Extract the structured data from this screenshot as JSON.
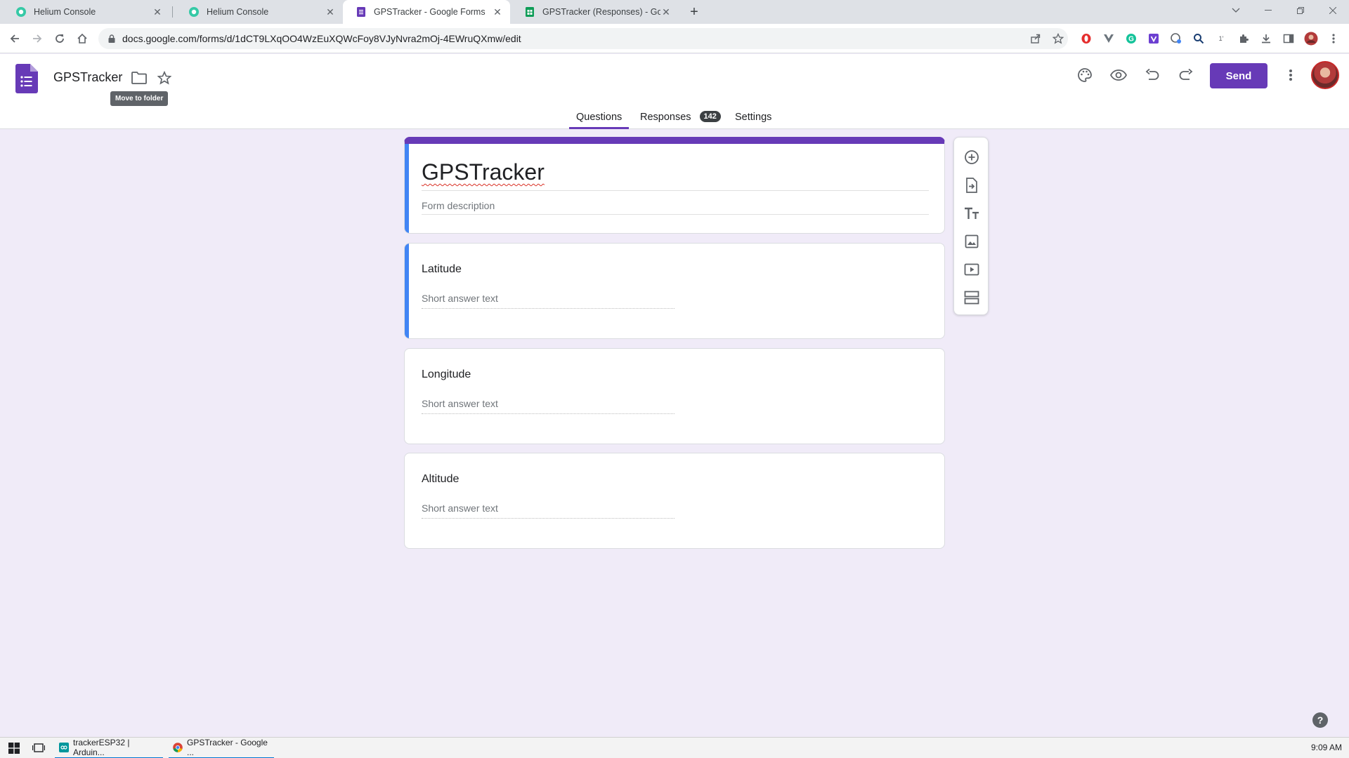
{
  "browser": {
    "tabs": [
      {
        "title": "Helium Console",
        "favicon": "helium-icon",
        "active": false
      },
      {
        "title": "Helium Console",
        "favicon": "helium-icon",
        "active": false
      },
      {
        "title": "GPSTracker - Google Forms",
        "favicon": "google-forms-icon",
        "active": true
      },
      {
        "title": "GPSTracker (Responses) - Googl",
        "favicon": "google-sheets-icon",
        "active": false
      }
    ],
    "url": "docs.google.com/forms/d/1dCT9LXqOO4WzEuXQWcFoy8VJyNvra2mOj-4EWruQXmw/edit"
  },
  "header": {
    "doc_title": "GPSTracker",
    "tooltip": "Move to folder",
    "send_label": "Send",
    "nav": {
      "questions": "Questions",
      "responses": "Responses",
      "responses_count": "142",
      "settings": "Settings"
    }
  },
  "form": {
    "title": "GPSTracker",
    "description_placeholder": "Form description",
    "questions": [
      {
        "title": "Latitude",
        "placeholder": "Short answer text",
        "type": "short-answer"
      },
      {
        "title": "Longitude",
        "placeholder": "Short answer text",
        "type": "short-answer"
      },
      {
        "title": "Altitude",
        "placeholder": "Short answer text",
        "type": "short-answer"
      }
    ]
  },
  "side_toolbar": [
    "add-question-icon",
    "import-questions-icon",
    "add-title-icon",
    "add-image-icon",
    "add-video-icon",
    "add-section-icon"
  ],
  "taskbar": {
    "items": [
      {
        "label": "trackerESP32 | Arduin...",
        "icon": "arduino-icon"
      },
      {
        "label": "GPSTracker - Google ...",
        "icon": "chrome-icon"
      }
    ],
    "clock": "9:09 AM"
  },
  "colors": {
    "accent": "#673ab7",
    "page_background": "#f0ebf8",
    "selected_bar": "#4285f4"
  }
}
